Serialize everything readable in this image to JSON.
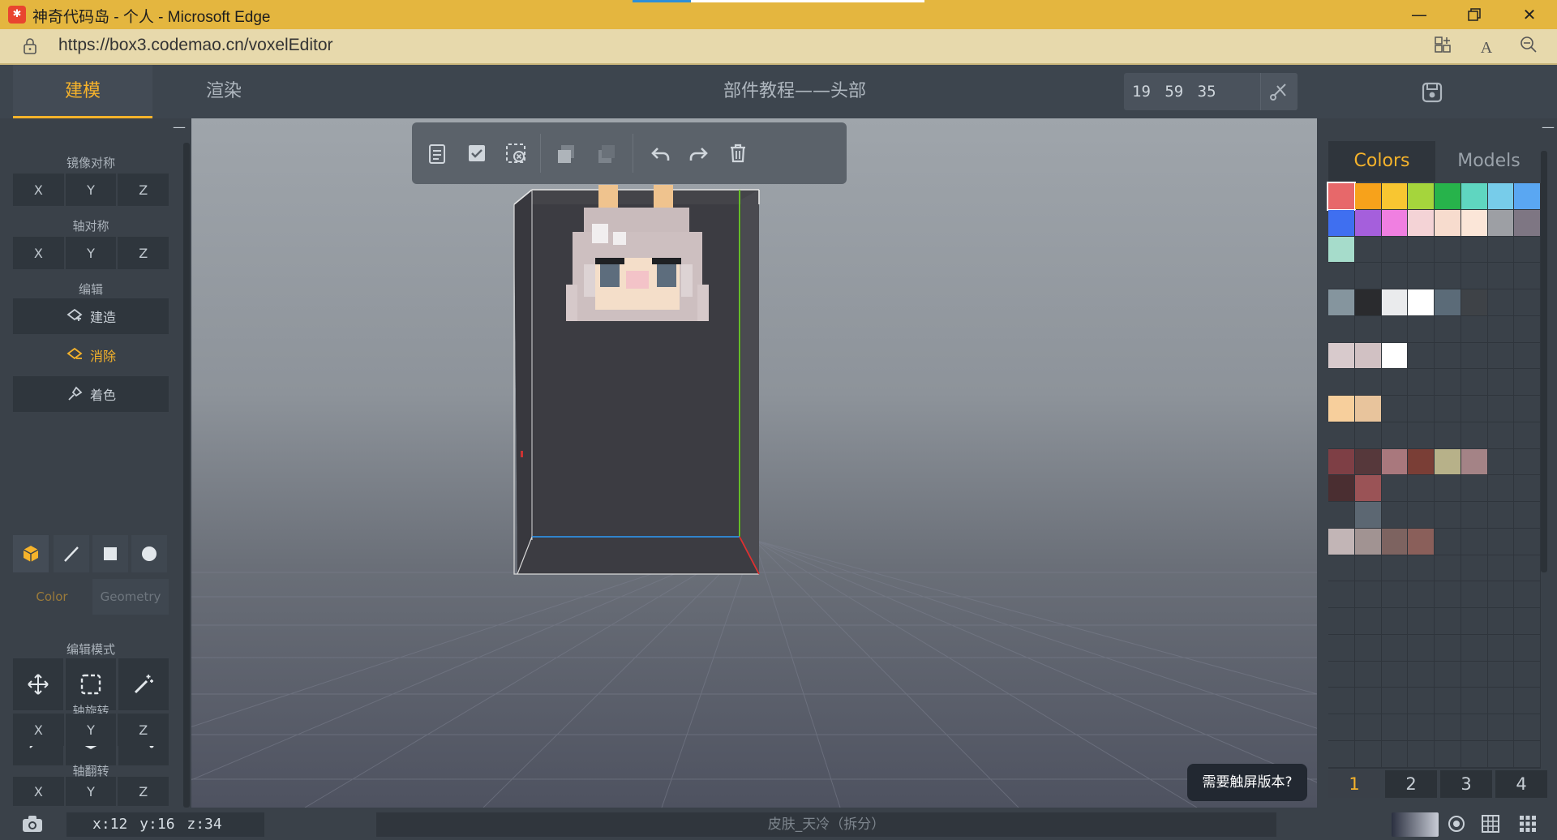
{
  "browser": {
    "window_title": "神奇代码岛 - 个人 - Microsoft Edge",
    "url_host": "https://box3.codemao.cn/voxelEditor",
    "favicon_glyph": "✱"
  },
  "app": {
    "tabs": [
      {
        "label": "建模"
      },
      {
        "label": "渲染"
      }
    ],
    "doc_title": "部件教程——头部",
    "coords": "19 59 35"
  },
  "left_panel": {
    "mirror_title": "镜像对称",
    "axis_sym_title": "轴对称",
    "edit_title": "编辑",
    "build_label": "建造",
    "erase_label": "消除",
    "paint_label": "着色",
    "color_tab": "Color",
    "geometry_tab": "Geometry",
    "edit_mode_title": "编辑模式",
    "fva": [
      "F",
      "V",
      "A"
    ],
    "rotate_title": "轴旋转",
    "flip_title": "轴翻转",
    "axes": [
      "X",
      "Y",
      "Z"
    ]
  },
  "right_panel": {
    "tabs": [
      {
        "label": "Colors"
      },
      {
        "label": "Models"
      }
    ],
    "pages": [
      "1",
      "2",
      "3",
      "4"
    ],
    "palette_rows": [
      [
        "#e7686a",
        "#f7a21b",
        "#f8c631",
        "#a5d53c",
        "#27b34b",
        "#5fd6c0",
        "#77ccea",
        "#5aa7f2"
      ],
      [
        "#3f6ff0",
        "#a55fdc",
        "#f07fe1",
        "#f4d3d6",
        "#f7dcce",
        "#fbe6d8",
        "#9d9fa4",
        "#7e7683"
      ],
      [
        "#a6dccb"
      ],
      [],
      [
        "#85959e",
        "#2a2b2e",
        "#eaebed",
        "#ffffff",
        "#5b6b78",
        "#3e4247"
      ],
      [],
      [
        "#d8cacc",
        "#d1c1c3",
        "#ffffff"
      ],
      [],
      [
        "#f7cf9c",
        "#e8c49c"
      ],
      [],
      [
        "#7e3f45",
        "#56383b",
        "#a9787d",
        "#7a3e36",
        "#b7b189",
        "#a48386"
      ],
      [
        "#4a2e31",
        "#9a5356"
      ],
      [
        "",
        "#5c6772"
      ],
      [
        "#c2b5b6",
        "#a19392",
        "#7d6360",
        "#8a5f5a"
      ]
    ],
    "selected_color": "#e7686a"
  },
  "viewport": {
    "touch_tip": "需要触屏版本?"
  },
  "status": {
    "coords": "x:12 y:16 z:34",
    "model_name": "皮肤_天冷（拆分）"
  }
}
